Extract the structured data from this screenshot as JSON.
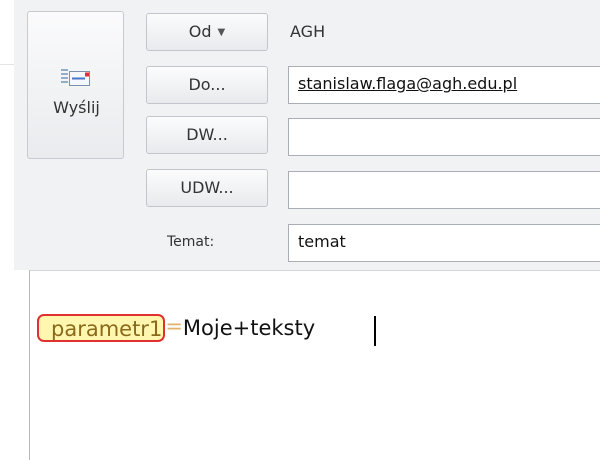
{
  "compose": {
    "send_label": "Wyślij",
    "from_button_label": "Od",
    "from_value": "AGH",
    "to_button_label": "Do...",
    "to_value": "stanislaw.flaga@agh.edu.pl",
    "cc_button_label": "DW...",
    "cc_value": "",
    "bcc_button_label": "UDW...",
    "bcc_value": "",
    "subject_label": "Temat:",
    "subject_value": "temat",
    "body": {
      "param_text": "parametr1",
      "equals_sign": "=",
      "rest_text": "Moje+teksty"
    }
  },
  "colors": {
    "header_bg": "#f1f2f4",
    "highlight_bg": "#fff7b0",
    "highlight_border": "#e0302f",
    "param_text": "#8a6a1a"
  },
  "icons": [
    "send-envelope-icon",
    "dropdown-arrow-icon"
  ]
}
